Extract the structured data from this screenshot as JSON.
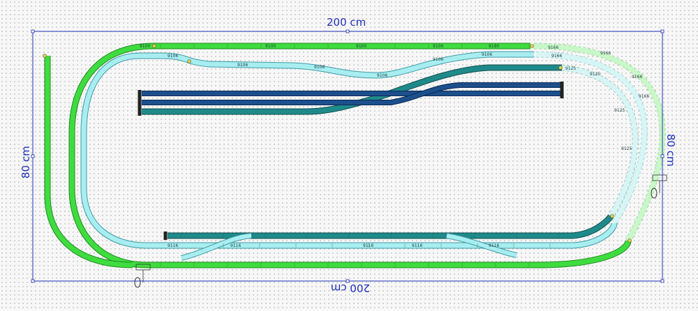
{
  "dimensions": {
    "top": "200 cm",
    "bottom": "200 cm",
    "left": "80 cm",
    "right": "80 cm"
  },
  "colors": {
    "frame": "#1c2fb8",
    "outer_track": "#3fdc3f",
    "outer_track_edge": "#1f8a1f",
    "middle_track": "#a8eef0",
    "middle_track_edge": "#3f9aa6",
    "inner_track": "#1f8a8a",
    "inner_track_edge": "#0f4f4f",
    "siding_track": "#1c4f8c",
    "siding_track_edge": "#0c2a55",
    "planned_green": "#c8f7c8",
    "planned_cyan": "#d6f5f5",
    "buffer_stop": "#222222",
    "signal_marker": "#e6d23a"
  },
  "track_labels": {
    "curve_outer": "9166",
    "curve_middle": "9106",
    "curve_inner": "9125",
    "straight_long": "9100",
    "straight_mid": "9116"
  }
}
